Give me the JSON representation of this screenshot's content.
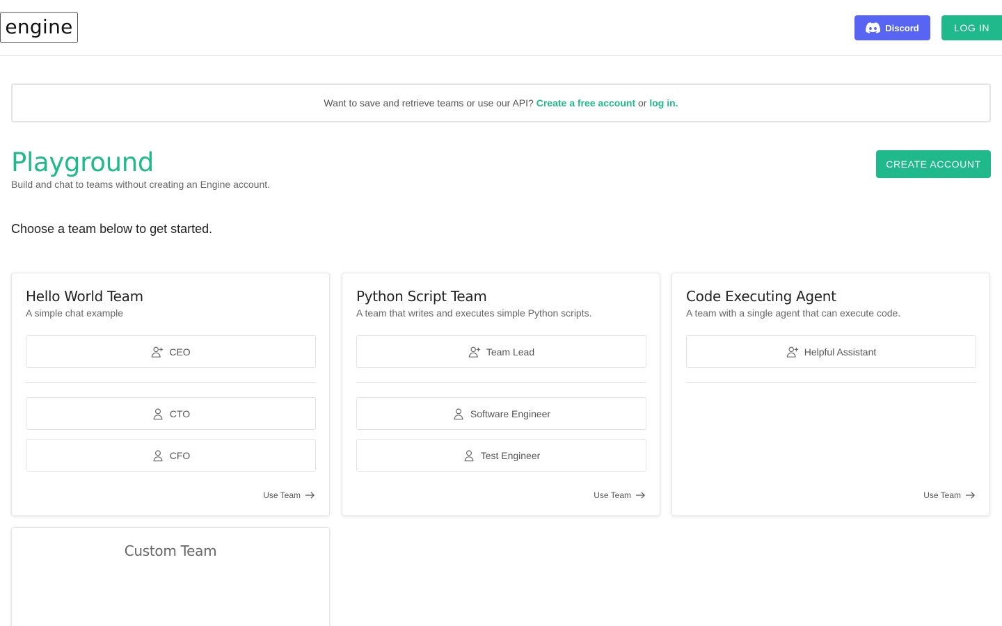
{
  "header": {
    "logo_text": "engine",
    "discord_label": "Discord",
    "login_label": "LOG IN"
  },
  "banner": {
    "text_before": "Want to save and retrieve teams or use our API?",
    "link_create": "Create a free account",
    "text_or": "or",
    "link_login": "log in",
    "text_end": "."
  },
  "page": {
    "title": "Playground",
    "subtitle": "Build and chat to teams without creating an Engine account.",
    "create_account_label": "CREATE ACCOUNT",
    "choose_text": "Choose a team below to get started."
  },
  "teams": [
    {
      "title": "Hello World Team",
      "description": "A simple chat example",
      "lead": "CEO",
      "members": [
        "CTO",
        "CFO"
      ],
      "use_label": "Use Team"
    },
    {
      "title": "Python Script Team",
      "description": "A team that writes and executes simple Python scripts.",
      "lead": "Team Lead",
      "members": [
        "Software Engineer",
        "Test Engineer"
      ],
      "use_label": "Use Team"
    },
    {
      "title": "Code Executing Agent",
      "description": "A team with a single agent that can execute code.",
      "lead": "Helpful Assistant",
      "members": [],
      "use_label": "Use Team"
    }
  ],
  "custom_team": {
    "title": "Custom Team"
  },
  "colors": {
    "accent": "#1fb98b",
    "discord": "#5865f2"
  }
}
